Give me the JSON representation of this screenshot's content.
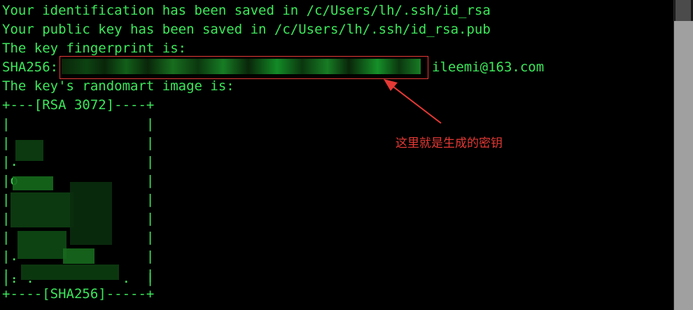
{
  "terminal": {
    "lines": [
      "Your identification has been saved in /c/Users/lh/.ssh/id_rsa",
      "Your public key has been saved in /c/Users/lh/.ssh/id_rsa.pub",
      "The key fingerprint is:",
      "SHA256:",
      "The key's randomart image is:",
      "+---[RSA 3072]----+",
      "|                 |",
      "|                 |",
      "|.                |",
      "|o                |",
      "|                 |",
      "|                 |",
      "|                 |",
      "|.                |",
      "|.                |",
      "|. .           .  |",
      "+----[SHA256]-----+"
    ],
    "fingerprint_suffix": "ileemi@163.com"
  },
  "annotation": {
    "text": "这里就是生成的密钥"
  },
  "colors": {
    "terminal_text": "#3be85a",
    "background": "#000000",
    "annotation": "#e53935"
  }
}
